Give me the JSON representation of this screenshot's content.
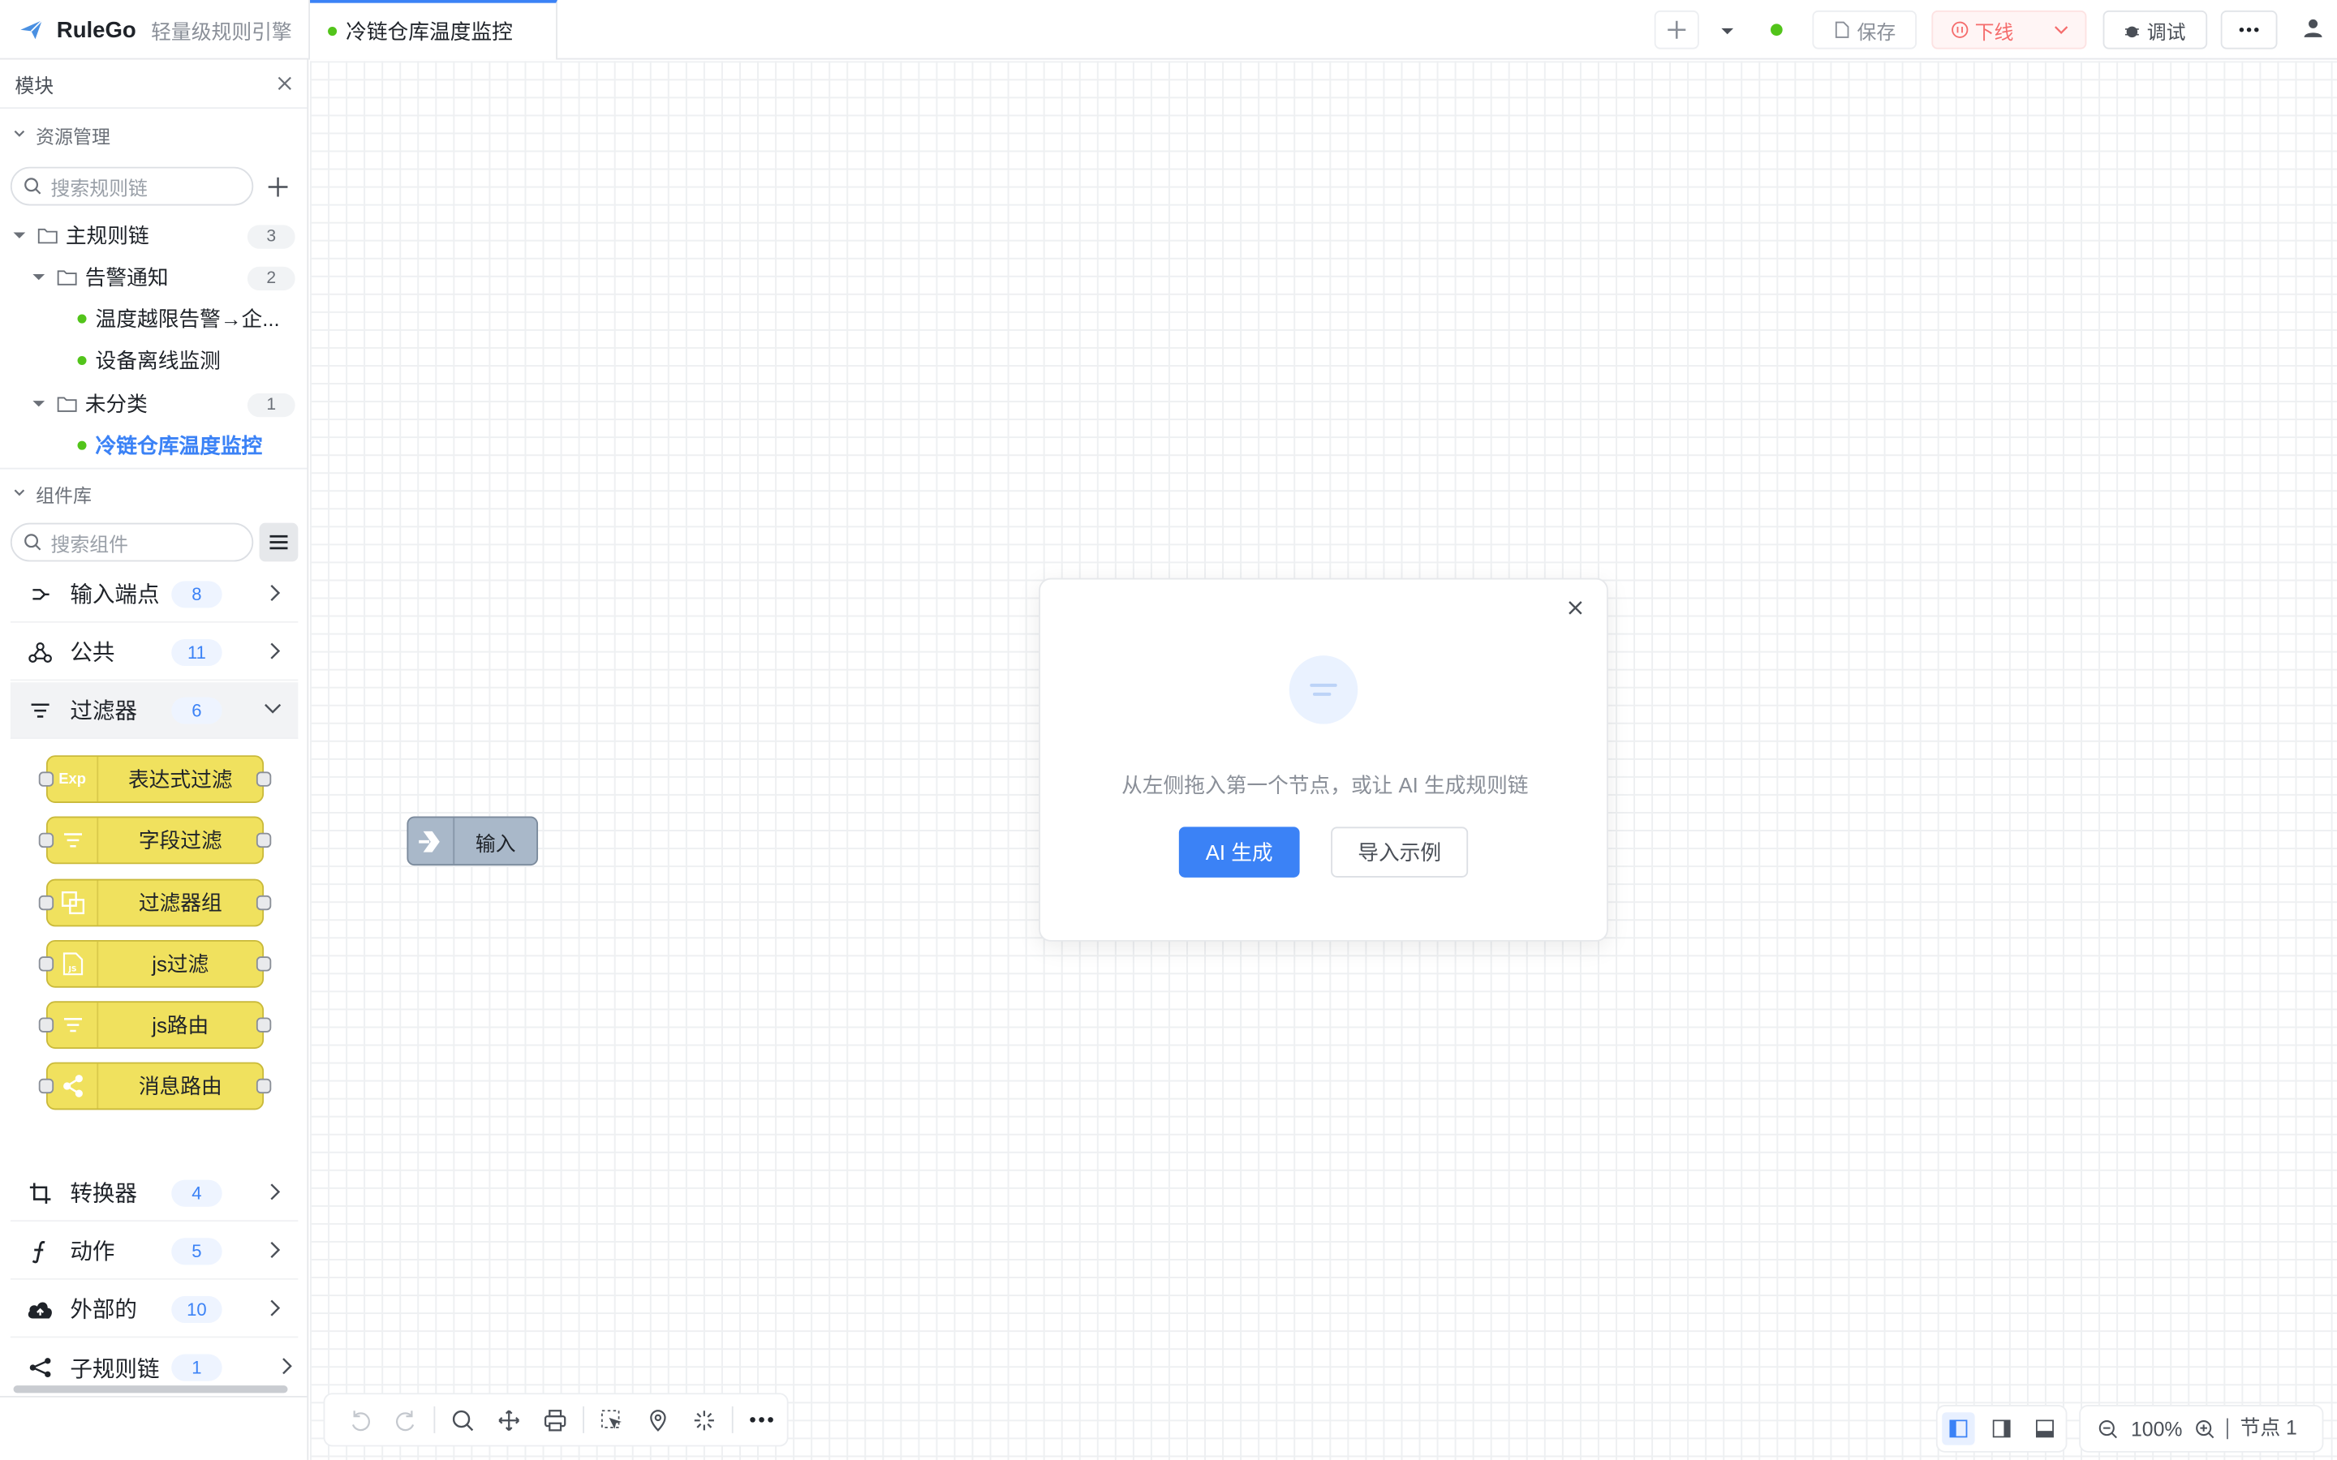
{
  "app": {
    "name": "RuleGo",
    "subtitle": "轻量级规则引擎"
  },
  "tab": {
    "label": "冷链仓库温度监控"
  },
  "header": {
    "save_label": "保存",
    "offline_label": "下线",
    "debug_label": "调试"
  },
  "sidebar": {
    "title": "模块",
    "resource_section": "资源管理",
    "search_placeholder": "搜索规则链",
    "tree": [
      {
        "label": "主规则链",
        "count": "3"
      },
      {
        "label": "告警通知",
        "count": "2"
      },
      {
        "label": "温度越限告警→企..."
      },
      {
        "label": "设备离线监测"
      },
      {
        "label": "未分类",
        "count": "1"
      },
      {
        "label": "冷链仓库温度监控"
      }
    ],
    "component_section": "组件库",
    "component_search_placeholder": "搜索组件",
    "categories": [
      {
        "label": "输入端点",
        "count": "8"
      },
      {
        "label": "公共",
        "count": "11"
      },
      {
        "label": "过滤器",
        "count": "6"
      },
      {
        "label": "转换器",
        "count": "4"
      },
      {
        "label": "动作",
        "count": "5"
      },
      {
        "label": "外部的",
        "count": "10"
      },
      {
        "label": "子规则链",
        "count": "1"
      }
    ],
    "filter_components": [
      {
        "label": "表达式过滤",
        "icon_text": "Exp"
      },
      {
        "label": "字段过滤"
      },
      {
        "label": "过滤器组"
      },
      {
        "label": "js过滤"
      },
      {
        "label": "js路由"
      },
      {
        "label": "消息路由"
      }
    ]
  },
  "canvas": {
    "node_label": "输入",
    "empty_message": "从左侧拖入第一个节点，或让 AI 生成规则链",
    "ai_button": "AI 生成",
    "import_button": "导入示例"
  },
  "footer": {
    "zoom": "100%",
    "node_count": "节点 1"
  },
  "colors": {
    "accent": "#3b82f6",
    "online": "#52c41a",
    "offline": "#f56c6c",
    "filter_node": "#f0e15e",
    "input_node": "#a9b8c9"
  }
}
